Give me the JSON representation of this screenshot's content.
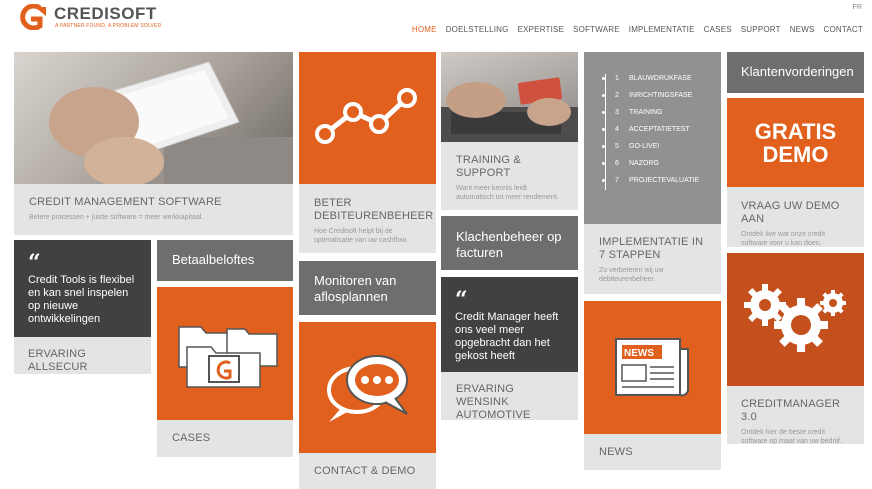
{
  "header": {
    "logo_text": "CREDISOFT",
    "tagline": "A PARTNER FOUND, A PROBLEM SOLVED",
    "lang": "FR",
    "nav": [
      {
        "label": "HOME",
        "active": true
      },
      {
        "label": "DOELSTELLING"
      },
      {
        "label": "EXPERTISE"
      },
      {
        "label": "SOFTWARE"
      },
      {
        "label": "IMPLEMENTATIE"
      },
      {
        "label": "CASES"
      },
      {
        "label": "SUPPORT"
      },
      {
        "label": "NEWS"
      },
      {
        "label": "CONTACT"
      }
    ]
  },
  "tiles": {
    "credit_mgmt": {
      "title": "CREDIT MANAGEMENT SOFTWARE",
      "desc": "Betere processen + juiste software = meer werkkapitaal."
    },
    "beter": {
      "title": "BETER DEBITEURENBEHEER",
      "desc": "Hoe Credisoft helpt bij de optimalisatie van uw cashflow."
    },
    "training": {
      "title": "TRAINING & SUPPORT",
      "desc": "Want meer kennis leidt automatisch tot meer rendement."
    },
    "steps": [
      "BLAUWDRUKFASE",
      "INRICHTINGSFASE",
      "TRAINING",
      "ACCEPTATIETEST",
      "GO-LIVE!",
      "NAZORG",
      "PROJECTEVALUATIE"
    ],
    "implementatie": {
      "title": "IMPLEMENTATIE IN 7 STAPPEN",
      "desc": "Zo verbeteren wij uw debiteurenbeheer."
    },
    "klanten": {
      "title": "Klantenvorderingen"
    },
    "gratis": {
      "line1": "GRATIS",
      "line2": "DEMO"
    },
    "vraag": {
      "title": "VRAAG UW DEMO AAN",
      "desc": "Ontdek live wat onze credit software voor u kan doen."
    },
    "quote1": {
      "text": "Credit Tools is flexibel en kan snel inspelen op nieuwe ontwikkelingen",
      "source": "ERVARING ALLSECUR"
    },
    "betaal": {
      "title": "Betaalbeloftes"
    },
    "cases": {
      "title": "CASES"
    },
    "monitoren": {
      "title": "Monitoren van aflosplannen"
    },
    "contact": {
      "title": "CONTACT & DEMO"
    },
    "klachten": {
      "title": "Klachenbeheer op facturen"
    },
    "quote2": {
      "text": "Credit Manager heeft ons veel meer opgebracht dan het gekost heeft",
      "source": "ERVARING WENSINK AUTOMOTIVE"
    },
    "news": {
      "title": "NEWS",
      "icon_label": "NEWS"
    },
    "creditmanager": {
      "title": "CREDITMANAGER 3.0",
      "desc": "Ontdek hier de beste credit software op maat van uw bedrijf."
    }
  }
}
